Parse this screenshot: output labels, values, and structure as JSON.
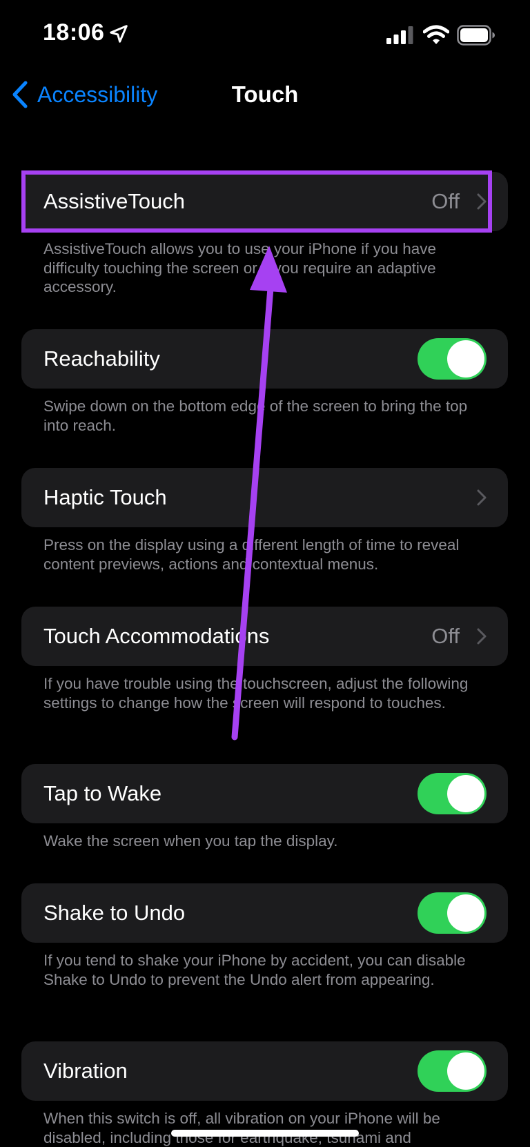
{
  "status_bar": {
    "time": "18:06",
    "icons": [
      "location-arrow-icon",
      "cellular-signal-icon",
      "wifi-icon",
      "battery-icon"
    ]
  },
  "nav": {
    "back_label": "Accessibility",
    "title": "Touch"
  },
  "colors": {
    "background": "#000000",
    "cell": "#1c1c1e",
    "accent": "#0a84ff",
    "toggle_on": "#30d158",
    "secondary_text": "#8d8d93",
    "annotation": "#a641f2"
  },
  "settings": [
    {
      "label": "AssistiveTouch",
      "value": "Off",
      "control": "disclosure",
      "footer": "AssistiveTouch allows you to use your iPhone if you have difficulty touching the screen or if you require an adaptive accessory."
    },
    {
      "label": "Reachability",
      "control": "toggle",
      "on": true,
      "footer": "Swipe down on the bottom edge of the screen to bring the top into reach."
    },
    {
      "label": "Haptic Touch",
      "control": "disclosure",
      "footer": "Press on the display using a different length of time to reveal content previews, actions and contextual menus."
    },
    {
      "label": "Touch Accommodations",
      "value": "Off",
      "control": "disclosure",
      "footer": "If you have trouble using the touchscreen, adjust the following settings to change how the screen will respond to touches."
    },
    {
      "label": "Tap to Wake",
      "control": "toggle",
      "on": true,
      "footer": "Wake the screen when you tap the display."
    },
    {
      "label": "Shake to Undo",
      "control": "toggle",
      "on": true,
      "footer": "If you tend to shake your iPhone by accident, you can disable Shake to Undo to prevent the Undo alert from appearing."
    },
    {
      "label": "Vibration",
      "control": "toggle",
      "on": true,
      "footer": "When this switch is off, all vibration on your iPhone will be disabled, including those for earthquake, tsunami and"
    }
  ]
}
